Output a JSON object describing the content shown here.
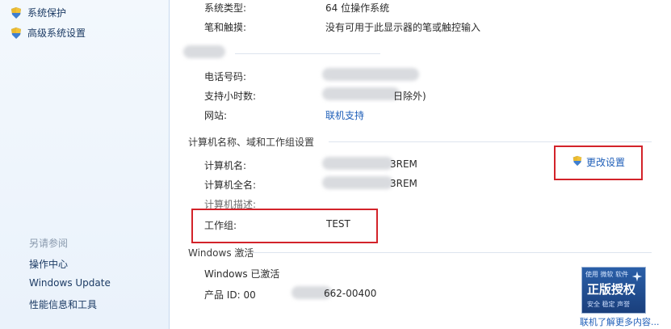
{
  "sidebar": {
    "items": [
      {
        "label": "系统保护",
        "icon": "shield-icon"
      },
      {
        "label": "高级系统设置",
        "icon": "shield-icon"
      }
    ],
    "see_also_title": "另请参阅",
    "see_also_links": [
      "操作中心",
      "Windows Update",
      "性能信息和工具"
    ]
  },
  "system": {
    "type_label": "系统类型:",
    "type_value": "64 位操作系统",
    "pen_label": "笔和触摸:",
    "pen_value": "没有可用于此显示器的笔或触控输入"
  },
  "support": {
    "phone_label": "电话号码:",
    "hours_label": "支持小时数:",
    "hours_value_visible": "日除外)",
    "website_label": "网站:",
    "website_link": "联机支持"
  },
  "computer_section": {
    "title": "计算机名称、域和工作组设置",
    "name_label": "计算机名:",
    "name_value_visible": "3REM",
    "fullname_label": "计算机全名:",
    "fullname_value_visible": "3REM",
    "desc_label": "计算机描述:",
    "workgroup_label": "工作组:",
    "workgroup_value": "TEST",
    "change_settings": "更改设置"
  },
  "activation": {
    "title": "Windows 激活",
    "status": "Windows 已激活",
    "product_id_label": "产品 ID: 00",
    "product_id_visible_tail": "662-00400",
    "badge_top": "使用 微软 软件",
    "badge_main": "正版授权",
    "badge_sub": "安全 稳定 声誉",
    "more_link": "联机了解更多内容..."
  },
  "colors": {
    "link": "#1f5fb9",
    "highlight": "#d3232a",
    "sidebar_bg": "#eaf2fb"
  }
}
